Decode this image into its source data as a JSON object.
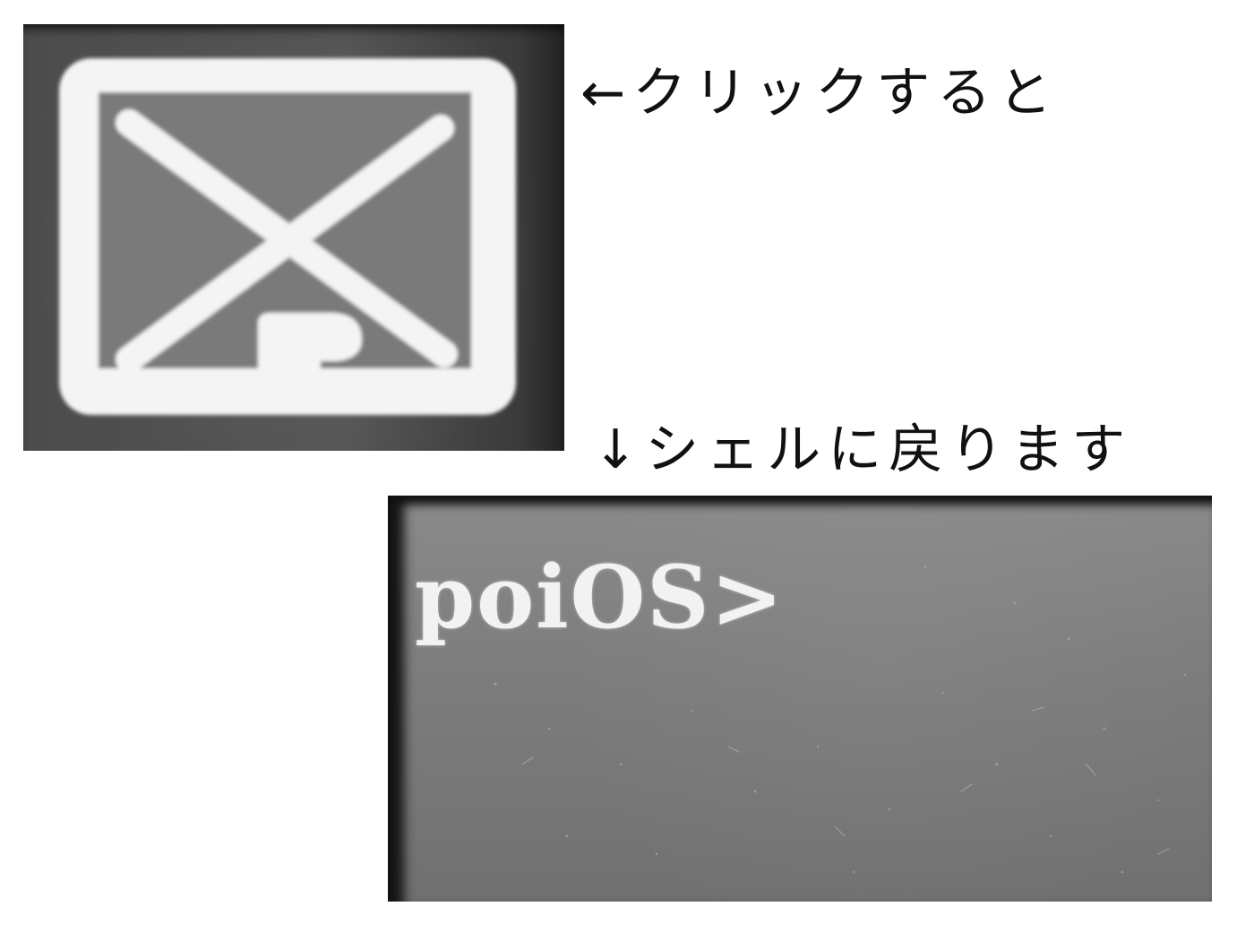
{
  "captions": {
    "top": "←クリックすると",
    "bottom": "↓シェルに戻ります"
  },
  "shell": {
    "prompt": "poiOS>"
  },
  "icons": {
    "close": "close-window-icon"
  }
}
